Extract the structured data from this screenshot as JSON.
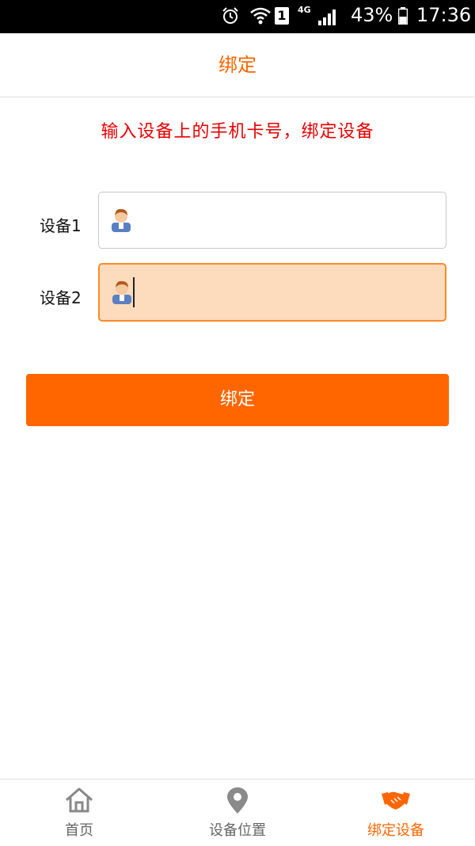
{
  "status_bar": {
    "sim_slot": "1",
    "network": "4G",
    "battery_percent": "43%",
    "time": "17:36"
  },
  "header": {
    "title": "绑定"
  },
  "instruction": "输入设备上的手机卡号，绑定设备",
  "form": {
    "device1": {
      "label": "设备1",
      "value": "",
      "placeholder": ""
    },
    "device2": {
      "label": "设备2",
      "value": "",
      "placeholder": ""
    }
  },
  "bind_button_label": "绑定",
  "bottom_nav": {
    "items": [
      {
        "label": "首页",
        "icon": "home-icon",
        "active": false
      },
      {
        "label": "设备位置",
        "icon": "location-pin-icon",
        "active": false
      },
      {
        "label": "绑定设备",
        "icon": "handshake-icon",
        "active": true
      }
    ]
  },
  "colors": {
    "accent": "#ff6600",
    "instruction": "#e60000",
    "active_field_bg": "#fcdcbc",
    "active_field_border": "#ff8a2a"
  }
}
